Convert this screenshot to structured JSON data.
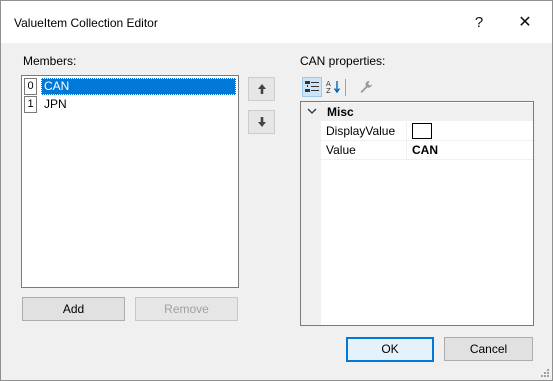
{
  "window": {
    "title": "ValueItem Collection Editor",
    "help": "?",
    "close": "✕"
  },
  "members": {
    "label": "Members:",
    "items": [
      {
        "index": "0",
        "name": "CAN",
        "selected": true
      },
      {
        "index": "1",
        "name": "JPN",
        "selected": false
      }
    ],
    "add_label": "Add",
    "remove_label": "Remove"
  },
  "properties": {
    "label": "CAN properties:",
    "category": "Misc",
    "rows": [
      {
        "name": "DisplayValue",
        "value": ""
      },
      {
        "name": "Value",
        "value": "CAN"
      }
    ]
  },
  "footer": {
    "ok_label": "OK",
    "cancel_label": "Cancel"
  },
  "colors": {
    "selection": "#0078d7",
    "dialog_bg": "#f0f0f0"
  }
}
